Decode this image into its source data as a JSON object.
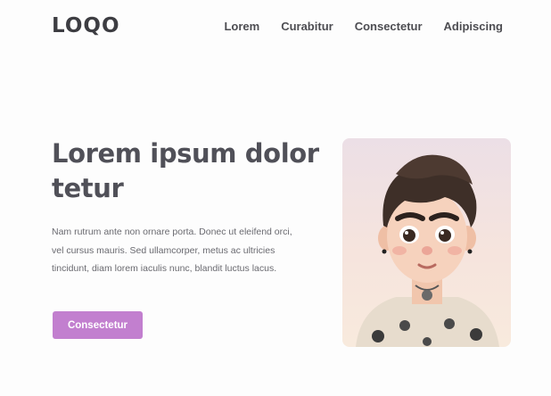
{
  "header": {
    "logo_text": "LOQO",
    "nav": [
      {
        "label": "Lorem"
      },
      {
        "label": "Curabitur"
      },
      {
        "label": "Consectetur"
      },
      {
        "label": "Adipiscing"
      }
    ]
  },
  "hero": {
    "title": "Lorem ipsum dolor tetur",
    "description": "Nam rutrum ante non ornare porta. Donec ut eleifend orci, vel cursus mauris. Sed ullamcorper, metus ac ultricies tincidunt, diam lorem iaculis nunc, blandit luctus lacus.",
    "cta_label": "Consectetur"
  },
  "colors": {
    "accent": "#c27fcf",
    "text": "#505058"
  }
}
